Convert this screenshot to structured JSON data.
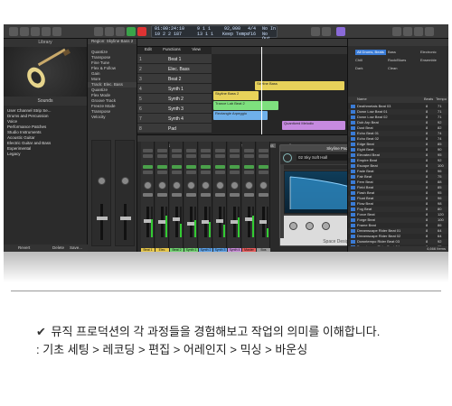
{
  "transport": {
    "lcd_position": "01:00:24:10",
    "lcd_bars": "10  2  2 187",
    "lcd_tempo": "92,000",
    "lcd_tempo_label": "Keep Tempo",
    "lcd_signature": "4/4",
    "lcd_division": "/16",
    "lcd_key": "No In",
    "lcd_key2": "No Out",
    "lcd_bar_a": "9  1  1",
    "lcd_bar_b": "13  1  1"
  },
  "library": {
    "title": "Library",
    "sounds_label": "Sounds",
    "items": [
      "User Channel Strip Se...",
      "Drums and Percussion",
      "Voice",
      "Performance Patches",
      "Studio Instruments",
      "Acoustic Guitar",
      "Electric Guitar and Bass",
      "Experimental",
      "Legacy"
    ],
    "footer": [
      "Revert",
      "Delete",
      "Save..."
    ]
  },
  "inspector": {
    "region_label": "Region: Skyline Bass 2",
    "rows": [
      "Quantize",
      "Transpose",
      "Fine Tune",
      "Flex & Follow",
      "Gain",
      "More"
    ],
    "track_label": "Track: Elec. Bass",
    "track_rows": [
      "Quantize",
      "Flex Mode",
      "Groove Track",
      "Freeze Mode",
      "Transpose",
      "Velocity"
    ]
  },
  "tracks": {
    "toolbar": [
      "Edit",
      "Functions",
      "View"
    ],
    "headers": [
      {
        "num": "1",
        "name": "Beat 1"
      },
      {
        "num": "2",
        "name": "Elec. Bass"
      },
      {
        "num": "3",
        "name": "Beat 2"
      },
      {
        "num": "4",
        "name": "Synth 1"
      },
      {
        "num": "5",
        "name": "Synth 2"
      },
      {
        "num": "6",
        "name": "Synth 3"
      },
      {
        "num": "7",
        "name": "Synth 4"
      },
      {
        "num": "8",
        "name": "Pad"
      }
    ],
    "regions": [
      "Skyline Bass",
      "Skyline Bass 2",
      "Trance Lab Beat 2",
      "Rectangle Arpeggio",
      "Quantized Melodic"
    ]
  },
  "mixer": {
    "toolbar": [
      "Edit",
      "Options",
      "View",
      "Single",
      "Tracks",
      "All"
    ],
    "strips": [
      {
        "label": "Beat 1",
        "color": "#e8c84a",
        "level": 0.55,
        "meter": 0.6
      },
      {
        "label": "Elec. Bass",
        "color": "#e8c84a",
        "level": 0.5,
        "meter": 0.7
      },
      {
        "label": "Beat 2",
        "color": "#6fd36f",
        "level": 0.6,
        "meter": 0.45
      },
      {
        "label": "Synth 1",
        "color": "#6fd36f",
        "level": 0.45,
        "meter": 0.55
      },
      {
        "label": "Synth 2",
        "color": "#5aa0e8",
        "level": 0.5,
        "meter": 0.5
      },
      {
        "label": "Synth 3",
        "color": "#5aa0e8",
        "level": 0.55,
        "meter": 0.4
      },
      {
        "label": "Synth 4",
        "color": "#c88ad8",
        "level": 0.5,
        "meter": 0.65
      },
      {
        "label": "Master Out",
        "color": "#e85a5a",
        "level": 0.6,
        "meter": 0.7
      },
      {
        "label": "Bus",
        "color": "#999999",
        "level": 0.5,
        "meter": 0.3
      }
    ]
  },
  "plugin": {
    "title": "Skyline Pad 1",
    "preset": "02 Sky Soft Hall",
    "tabs": [
      "Compare",
      "Copy",
      "Paste"
    ],
    "view": "View",
    "footer": "Space Designer"
  },
  "browser": {
    "tabs": [
      "Loop Packs:",
      "All Genres"
    ],
    "filters": [
      "All Drums, Beats",
      "Bass",
      "Electronic",
      "Chill",
      "Rock/Blues",
      "Ensemble",
      "Dark",
      "Clean"
    ],
    "columns": [
      "Name",
      "Beats",
      "Tempo"
    ],
    "rows": [
      {
        "name": "Deathmetals Beat 03",
        "beats": "8",
        "bpm": "71"
      },
      {
        "name": "Down Low Beat 01",
        "beats": "8",
        "bpm": "71"
      },
      {
        "name": "Down Low Beat 02",
        "beats": "8",
        "bpm": "71"
      },
      {
        "name": "Dub Arp Beat",
        "beats": "8",
        "bpm": "92"
      },
      {
        "name": "Dust Beat",
        "beats": "8",
        "bpm": "82"
      },
      {
        "name": "Echo Beat 01",
        "beats": "8",
        "bpm": "74"
      },
      {
        "name": "Echo Beat 02",
        "beats": "8",
        "bpm": "74"
      },
      {
        "name": "Edge Beat",
        "beats": "8",
        "bpm": "85"
      },
      {
        "name": "Eight Beat",
        "beats": "8",
        "bpm": "90"
      },
      {
        "name": "Elevated Beat",
        "beats": "8",
        "bpm": "95"
      },
      {
        "name": "Empire Beat",
        "beats": "8",
        "bpm": "92"
      },
      {
        "name": "Escape Beat",
        "beats": "8",
        "bpm": "100"
      },
      {
        "name": "Fade Beat",
        "beats": "8",
        "bpm": "96"
      },
      {
        "name": "Fair Beat",
        "beats": "8",
        "bpm": "75"
      },
      {
        "name": "Fern Beat",
        "beats": "8",
        "bpm": "88"
      },
      {
        "name": "Field Beat",
        "beats": "8",
        "bpm": "85"
      },
      {
        "name": "Flash Beat",
        "beats": "8",
        "bpm": "95"
      },
      {
        "name": "Float Beat",
        "beats": "8",
        "bpm": "96"
      },
      {
        "name": "Flow Beat",
        "beats": "8",
        "bpm": "98"
      },
      {
        "name": "Fog Beat",
        "beats": "8",
        "bpm": "80"
      },
      {
        "name": "Force Beat",
        "beats": "8",
        "bpm": "120"
      },
      {
        "name": "Forge Beat",
        "beats": "8",
        "bpm": "100"
      },
      {
        "name": "Frame Beat",
        "beats": "8",
        "bpm": "86"
      },
      {
        "name": "Dreamscape Rider Beat 01",
        "beats": "8",
        "bpm": "64"
      },
      {
        "name": "Dreamscape Rider Beat 02",
        "beats": "8",
        "bpm": "64"
      },
      {
        "name": "Downtempo Rider Beat 03",
        "beats": "8",
        "bpm": "92"
      },
      {
        "name": "Downtempo Rider Beat 04",
        "beats": "8",
        "bpm": "95"
      }
    ],
    "footer": "4,666 Items"
  },
  "caption": {
    "check": "✔",
    "line1": "뮤직 프로덕션의 각 과정들을 경험해보고 작업의 의미를 이해합니다.",
    "line2": ": 기초 세팅 > 레코딩 > 편집 > 어레인지 > 믹싱 > 바운싱"
  }
}
